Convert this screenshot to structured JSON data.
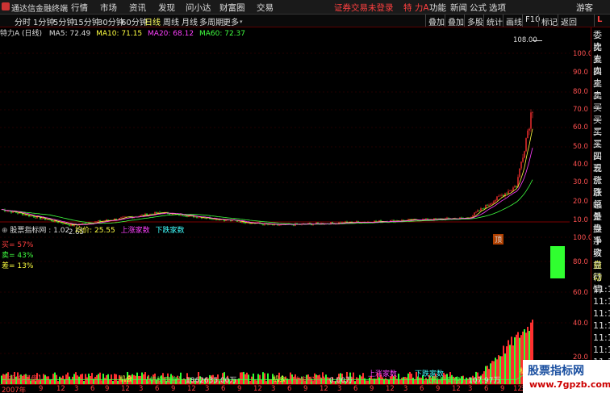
{
  "app": {
    "title": "通达信金融终端",
    "menu": [
      "行情",
      "市场",
      "资讯",
      "发现",
      "问小达",
      "财富圈",
      "交易"
    ],
    "login_status": "证券交易未登录",
    "stock_short": "特 力A",
    "menu_right": [
      "功能",
      "新闻",
      "公式",
      "选项"
    ],
    "user": "游客"
  },
  "toolbar": {
    "periods": [
      "分时",
      "1分钟",
      "5分钟",
      "15分钟",
      "30分钟",
      "60分钟",
      "日线",
      "周线",
      "月线",
      "多周期",
      "更多"
    ],
    "active_period": "日线",
    "right": [
      "叠加",
      "叠加",
      "多股",
      "统计",
      "画线",
      "F10",
      "标记",
      "返回"
    ],
    "right_corner": "L"
  },
  "chart_header": {
    "stock": "特力A (日线)",
    "ma5": "MA5: 72.49",
    "ma10": "MA10: 71.15",
    "ma20": "MA20: 68.12",
    "ma60": "MA60: 72.37",
    "peak_label": "108.00",
    "low_label": "2.65",
    "ding": "顶"
  },
  "price_axis": [
    "100.0",
    "90.0",
    "80.0",
    "70.0",
    "60.0",
    "50.0",
    "40.0",
    "30.0",
    "20.0",
    "10.0"
  ],
  "right_panel": [
    "委比",
    "卖五",
    "卖四",
    "卖三",
    "卖二",
    "卖一",
    "买一",
    "买二",
    "买三",
    "买四",
    "买五",
    "现价",
    "涨跌",
    "涨幅",
    "总量",
    "外盘",
    "换手",
    "净资",
    "收益",
    "自动",
    "行情",
    "11:1",
    "11:1",
    "11:1",
    "11:1",
    "11:1",
    "11:1",
    "11:1",
    "11:1",
    "11:1"
  ],
  "indicator": {
    "header": "股票指标网 : 1.02",
    "avg": "均价: 25.55",
    "up": "上涨家数",
    "down": "下跌家数",
    "sell_pct": "买= 57%",
    "buy_pct": "卖= 43%",
    "diff_pct": "差= 13%",
    "axis": [
      "100.0",
      "80.0",
      "60.0",
      "40.0",
      "20.0"
    ]
  },
  "bottom_labels": {
    "institution_buy": "【机构买盘】",
    "inst_sell_label": "【机构卖盘】",
    "inst_sell_val": "1862635.00万",
    "retail_buy": "【散户买盘】",
    "retail_buy_val": "0.00万",
    "retail_sell": "【散户卖盘】",
    "retail_sell_val": "107.97万",
    "jihui": "机会",
    "up_count": "上涨家数",
    "down_count": "下跌家数"
  },
  "dates": [
    "2007年",
    "9",
    "12",
    "3",
    "6",
    "9",
    "12",
    "3",
    "6",
    "9",
    "12",
    "3",
    "6",
    "9",
    "12",
    "3",
    "6",
    "9",
    "12",
    "3",
    "6",
    "9",
    "12",
    "3",
    "6",
    "9",
    "12",
    "3",
    "6",
    "9",
    "12",
    "3",
    "7"
  ],
  "watermark": {
    "line1": "股票指标网",
    "line2": "www.7gpzb.com"
  },
  "colors": {
    "up": "#ff3030",
    "down": "#30ff30",
    "ma5": "#ffffff",
    "ma10": "#ffff40",
    "ma20": "#ff40ff",
    "ma60": "#40ff40",
    "grid": "#5a0000"
  }
}
